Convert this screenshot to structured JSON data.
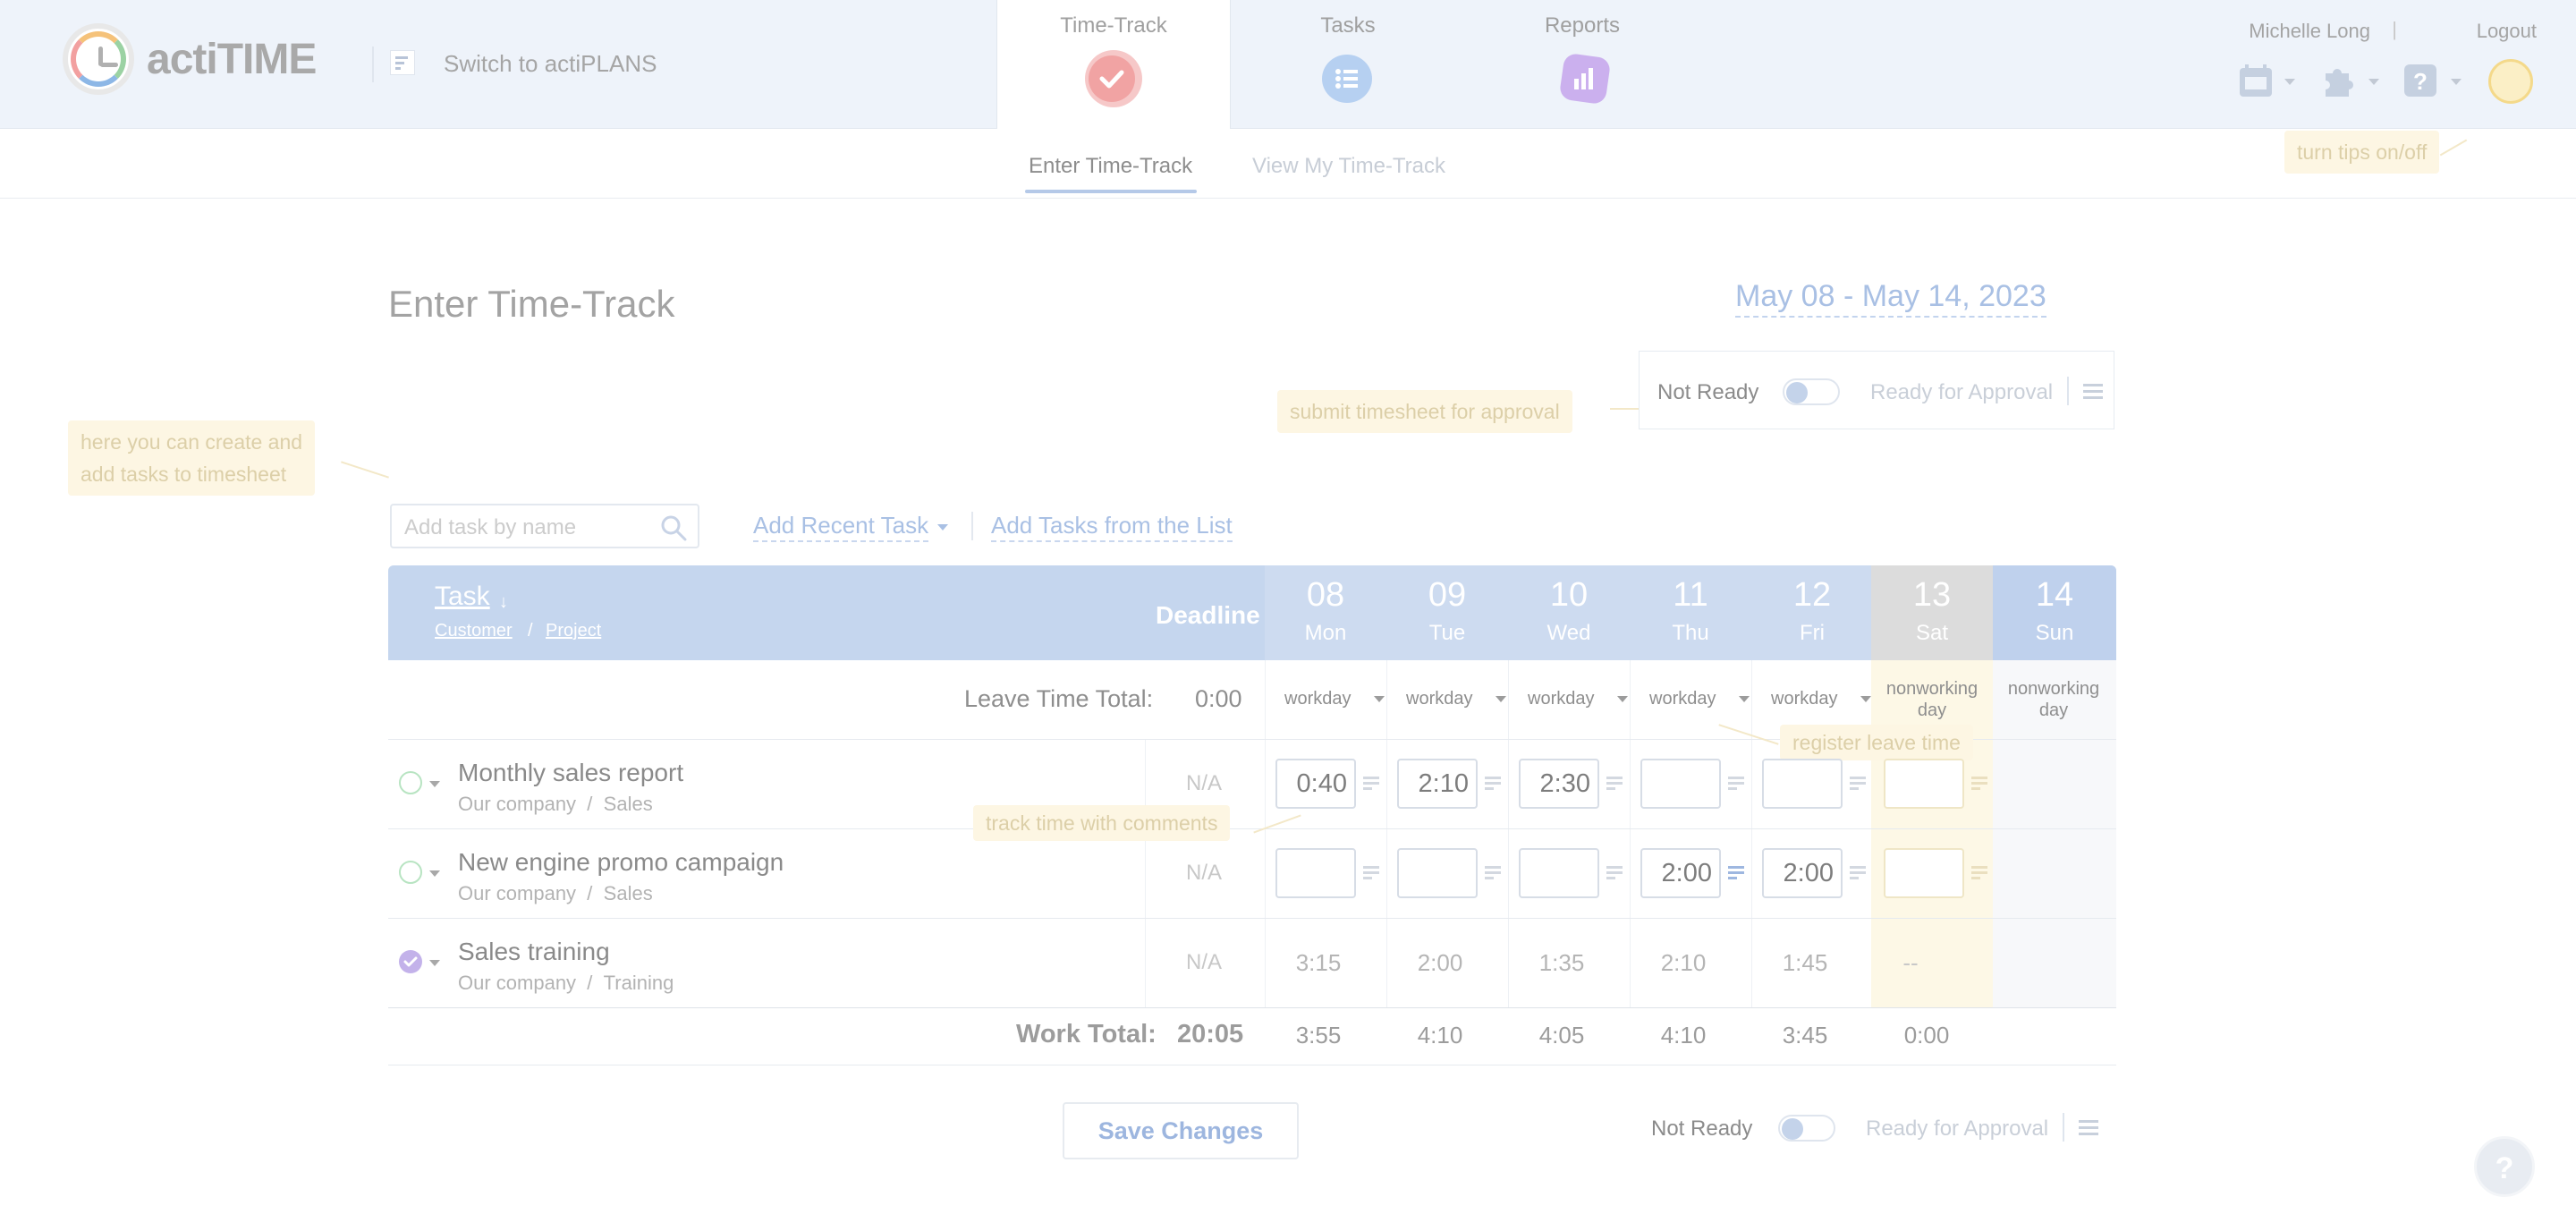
{
  "header": {
    "logo_text": "actiTIME",
    "switch_label": "Switch to actiPLANS",
    "nav": [
      {
        "label": "Time-Track",
        "icon": "check-icon",
        "color": "#f2a8a8",
        "active": true
      },
      {
        "label": "Tasks",
        "icon": "list-icon",
        "color": "#a9c8f0"
      },
      {
        "label": "Reports",
        "icon": "bar-chart-icon",
        "color": "#c6a8ea"
      }
    ],
    "user_name": "Michelle Long",
    "separator": "|",
    "logout_label": "Logout"
  },
  "subnav": {
    "tabs": [
      {
        "label": "Enter Time-Track",
        "active": true
      },
      {
        "label": "View My Time-Track",
        "active": false
      }
    ]
  },
  "tips": {
    "tips_toggle": "turn tips on/off",
    "submit": "submit timesheet for approval",
    "add_tasks_line1": "here you can create and",
    "add_tasks_line2": "add tasks to timesheet",
    "register_leave": "register leave time",
    "track_comments": "track time with comments"
  },
  "page": {
    "title": "Enter Time-Track",
    "date_range": "May 08 - May 14, 2023"
  },
  "approval": {
    "not_ready": "Not Ready",
    "ready_for_approval": "Ready for Approval"
  },
  "add_task": {
    "search_placeholder": "Add task by name",
    "recent_label": "Add Recent Task",
    "from_list_label": "Add Tasks from the List"
  },
  "table": {
    "task_header": "Task",
    "sort_arrow": "↓",
    "customer_header": "Customer",
    "slash": "/",
    "project_header": "Project",
    "deadline_header": "Deadline",
    "days": [
      {
        "num": "08",
        "dow": "Mon"
      },
      {
        "num": "09",
        "dow": "Tue"
      },
      {
        "num": "10",
        "dow": "Wed"
      },
      {
        "num": "11",
        "dow": "Thu"
      },
      {
        "num": "12",
        "dow": "Fri"
      },
      {
        "num": "13",
        "dow": "Sat"
      },
      {
        "num": "14",
        "dow": "Sun"
      }
    ],
    "leave_label": "Leave Time Total:",
    "leave_value": "0:00",
    "day_types": [
      "workday",
      "workday",
      "workday",
      "workday",
      "workday"
    ],
    "nonworking_line1": "nonworking",
    "nonworking_line2": "day",
    "tasks": [
      {
        "name": "Monthly sales report",
        "customer": "Our company",
        "project": "Sales",
        "deadline": "N/A",
        "values": [
          "0:40",
          "2:10",
          "2:30",
          "",
          "",
          ""
        ]
      },
      {
        "name": "New engine promo campaign",
        "customer": "Our company",
        "project": "Sales",
        "deadline": "N/A",
        "values": [
          "",
          "",
          "",
          "2:00",
          "2:00",
          ""
        ]
      },
      {
        "name": "Sales training",
        "customer": "Our company",
        "project": "Training",
        "deadline": "N/A",
        "values": [
          "3:15",
          "2:00",
          "1:35",
          "2:10",
          "1:45",
          "--"
        ]
      }
    ],
    "work_total_label": "Work Total:",
    "work_total_value": "20:05",
    "day_totals": [
      "3:55",
      "4:10",
      "4:05",
      "4:10",
      "3:45",
      "0:00"
    ]
  },
  "footer": {
    "save_label": "Save Changes",
    "not_ready": "Not Ready",
    "ready_for_approval": "Ready for Approval",
    "help_glyph": "?"
  }
}
